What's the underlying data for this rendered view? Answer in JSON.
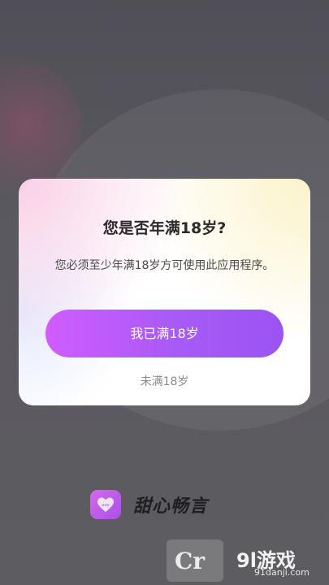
{
  "dialog": {
    "title": "您是否年满18岁?",
    "message": "您必须至少年满18岁方可使用此应用程序。",
    "confirm_label": "我已满18岁",
    "decline_label": "未满18岁"
  },
  "brand": {
    "app_name": "甜心畅言",
    "logo_icon": "heart-chat-icon",
    "logo_badge_text": "ooo"
  },
  "watermark": {
    "text": "9l游戏",
    "url": "91danji.com",
    "badge_text": "Cr"
  },
  "colors": {
    "confirm_gradient_start": "#d05cff",
    "confirm_gradient_end": "#9a54f2",
    "overlay_background": "#5a585e",
    "dialog_background": "#ffffff"
  }
}
